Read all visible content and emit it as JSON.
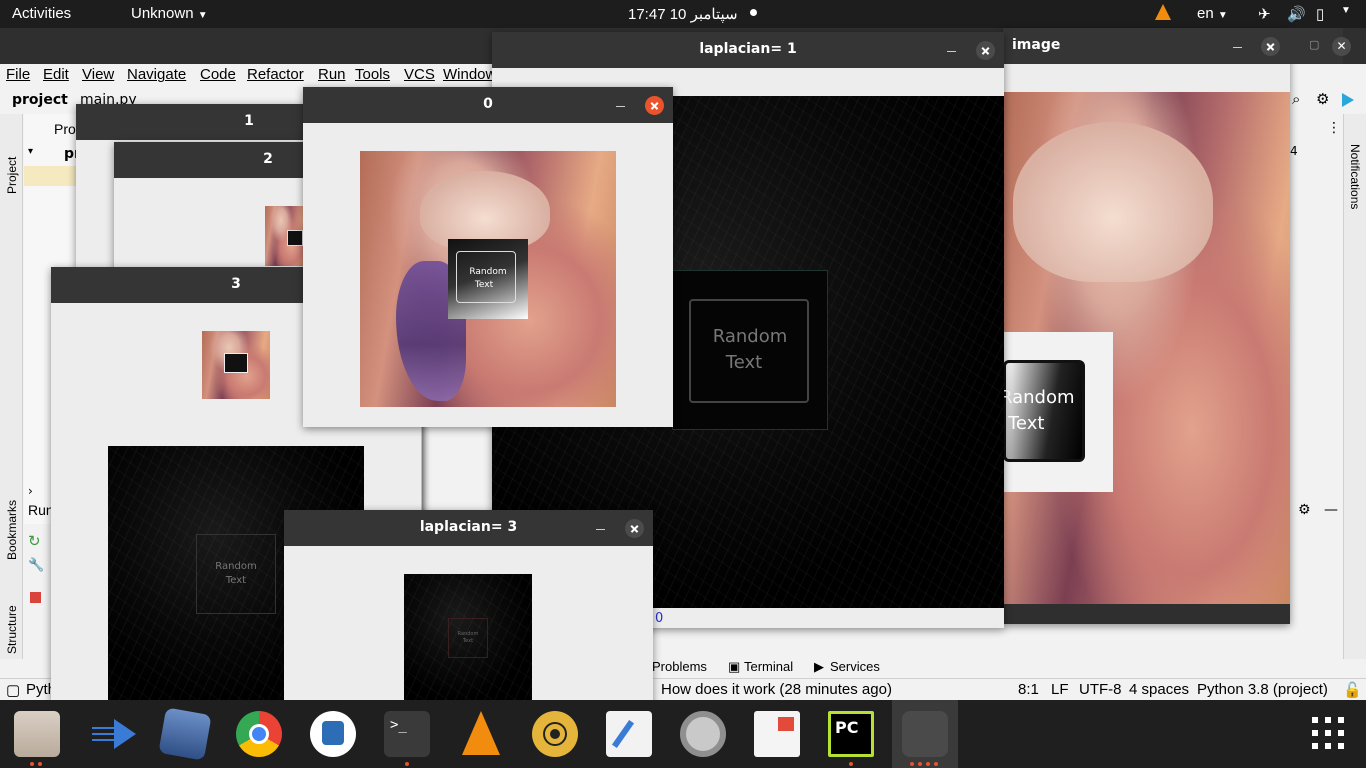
{
  "topbar": {
    "activities": "Activities",
    "app_menu": "Unknown",
    "clock": "سپتامبر 10  17:47",
    "language": "en"
  },
  "ide": {
    "menu": [
      "File",
      "Edit",
      "View",
      "Navigate",
      "Code",
      "Refactor",
      "Run",
      "Tools",
      "VCS",
      "Window"
    ],
    "project_name": "project",
    "file_tab": "main.py",
    "project_tool": "Pro",
    "project_root": "pr",
    "left_tools": [
      "Project",
      "Bookmarks",
      "Structure"
    ],
    "right_tools": [
      "Notifications"
    ],
    "run_label": "Run",
    "run_tab_label": "Pyth",
    "editor_hint": "4",
    "bottom_tabs": [
      "Problems",
      "Terminal",
      "Services"
    ],
    "status_message": "How does it work (28 minutes ago)",
    "status": {
      "position": "8:1",
      "line_sep": "LF",
      "encoding": "UTF-8",
      "indent": "4 spaces",
      "interpreter": "Python 3.8 (project)"
    },
    "console_value": "0"
  },
  "windows": {
    "w1": {
      "title": "1"
    },
    "w2": {
      "title": "2"
    },
    "w3": {
      "title": "3"
    },
    "w0": {
      "title": "0"
    },
    "wlap1": {
      "title": "laplacian= 1"
    },
    "wimage": {
      "title": "image"
    },
    "wlap3": {
      "title": "laplacian= 3"
    }
  },
  "overlay_text": {
    "line1": "Random",
    "line2": "Text"
  },
  "image_overlay_text": {
    "line1": "Random",
    "line2": "Text"
  },
  "dock": {
    "apps": [
      "files-icon",
      "anydesk-icon",
      "virtualbox-icon",
      "chrome-icon",
      "android-studio-icon",
      "terminal-icon",
      "vlc-icon",
      "rhythmbox-icon",
      "text-editor-icon",
      "settings-icon",
      "document-viewer-icon",
      "pycharm-icon",
      "opencv-window-icon"
    ],
    "show_apps": "grid-icon"
  }
}
